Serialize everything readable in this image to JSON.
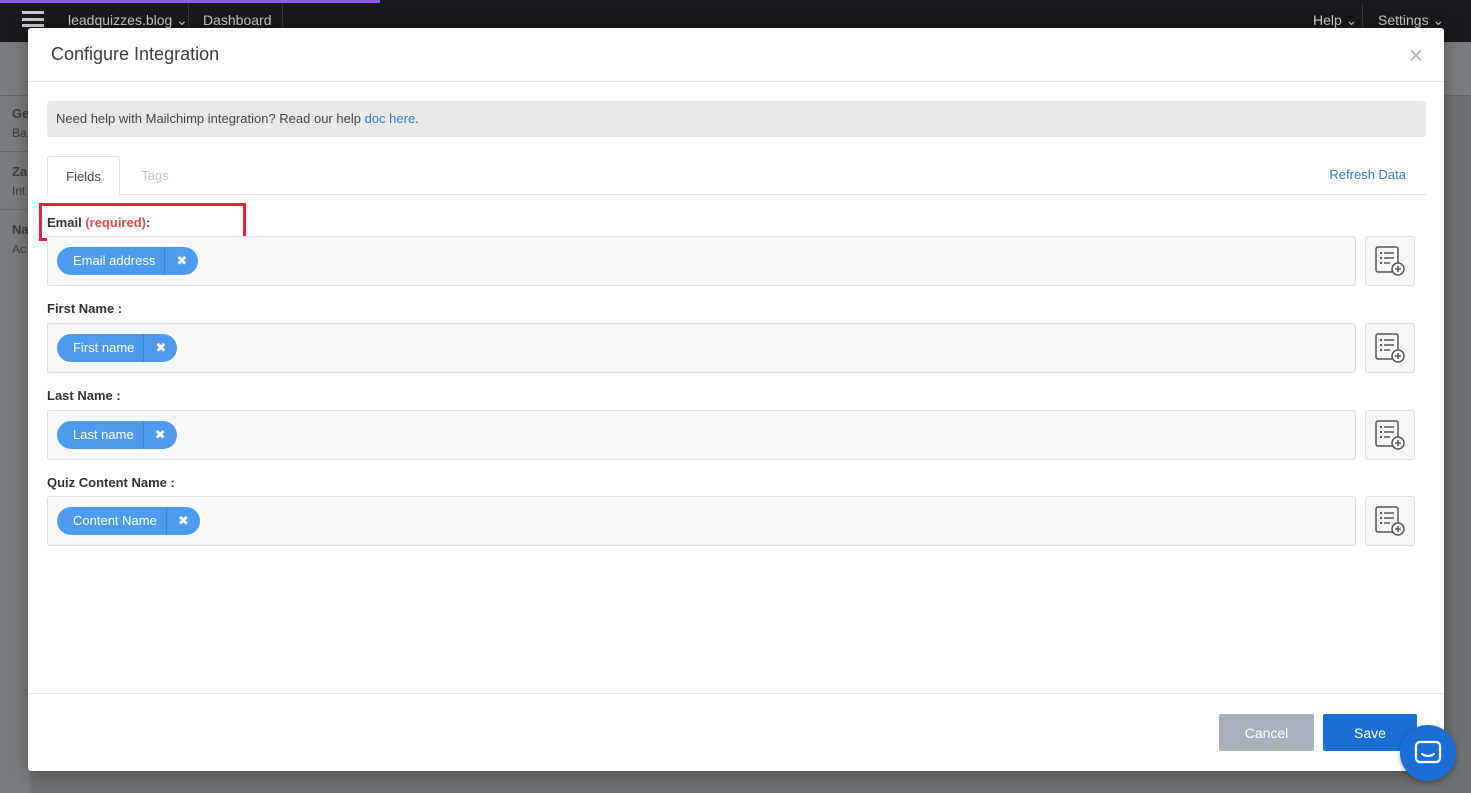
{
  "background": {
    "site_name": "leadquizzes.blog ⌄",
    "nav_dashboard": "Dashboard",
    "nav_help": "Help ⌄",
    "nav_settings": "Settings ⌄",
    "sidebar": [
      {
        "title": "Ge",
        "sub": "Ba"
      },
      {
        "title": "Za",
        "sub": "Int"
      },
      {
        "title": "Na",
        "sub": "Ac"
      }
    ]
  },
  "modal": {
    "title": "Configure Integration",
    "close_glyph": "×",
    "help_text": "Need help with Mailchimp integration? Read our help ",
    "help_link": "doc here",
    "help_suffix": ".",
    "tabs": [
      {
        "label": "Fields",
        "active": true
      },
      {
        "label": "Tags",
        "active": false
      }
    ],
    "refresh_label": "Refresh Data",
    "fields": [
      {
        "label": "Email",
        "required_text": "(required)",
        "suffix": ":",
        "chip": "Email address"
      },
      {
        "label": "First Name :",
        "chip": "First name"
      },
      {
        "label": "Last Name :",
        "chip": "Last name"
      },
      {
        "label": "Quiz Content Name :",
        "chip": "Content Name"
      }
    ],
    "chip_remove_glyph": "✖",
    "cancel_label": "Cancel",
    "save_label": "Save"
  },
  "colors": {
    "primary": "#1a6fd6",
    "chip": "#4d9bf0",
    "required": "#e24b4b",
    "highlight": "#e0263a"
  }
}
